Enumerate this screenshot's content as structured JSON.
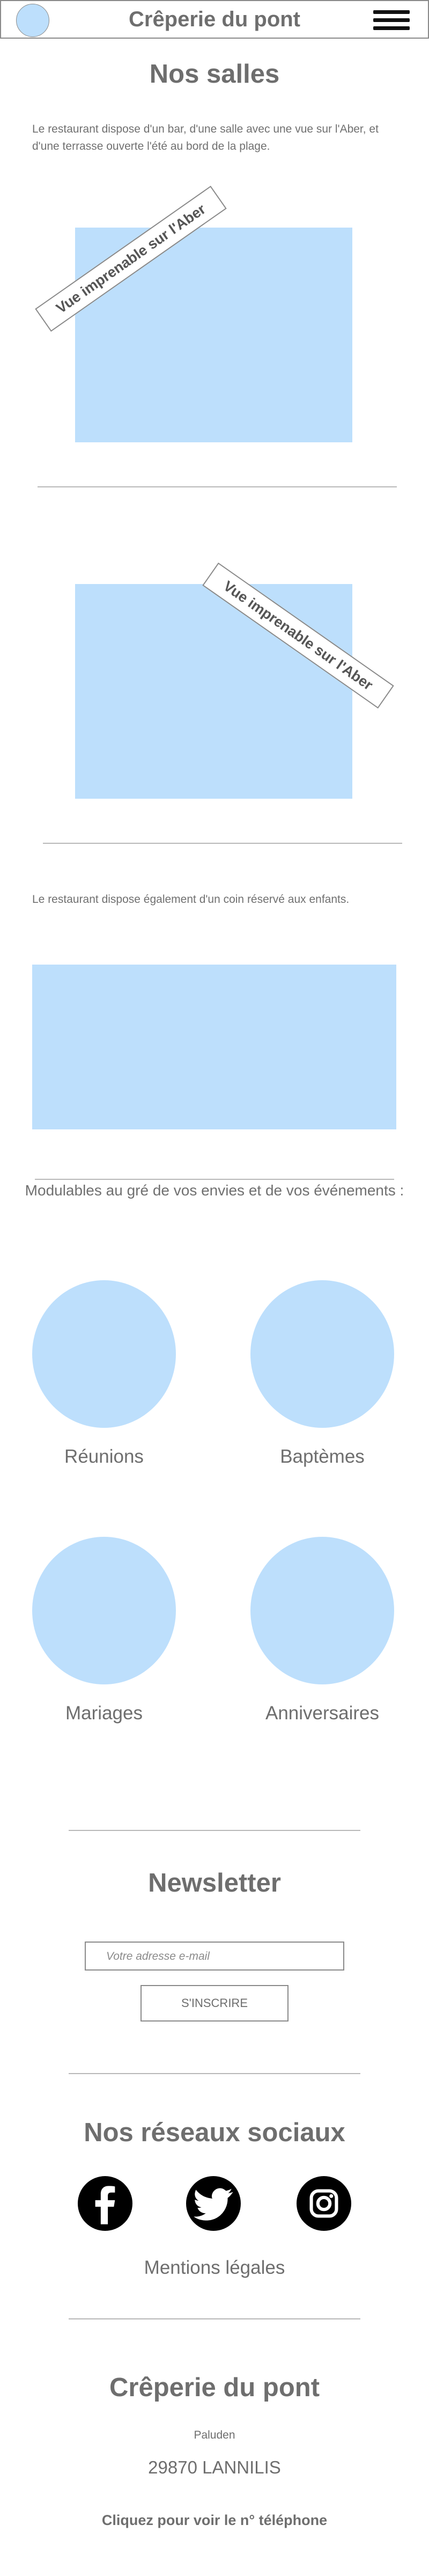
{
  "header": {
    "title": "Crêperie du pont"
  },
  "salles": {
    "title": "Nos salles",
    "intro": "Le restaurant dispose d'un bar, d'une salle avec une vue sur l'Aber, et d'une terrasse ouverte l'été au bord de la plage.",
    "banner1": "Vue imprenable sur l'Aber",
    "banner2": "Vue imprenable sur l'Aber",
    "kids_text": "Le restaurant dispose également d'un coin réservé aux enfants.",
    "modular_text": "Modulables au gré de vos envies et de vos événements :",
    "events": [
      "Réunions",
      "Baptèmes",
      "Mariages",
      "Anniversaires"
    ]
  },
  "newsletter": {
    "title": "Newsletter",
    "email_placeholder": "Votre adresse e-mail",
    "button_label": "S'INSCRIRE"
  },
  "social": {
    "title": "Nos réseaux sociaux",
    "icons": [
      "facebook-icon",
      "twitter-icon",
      "instagram-icon"
    ],
    "legal_link": "Mentions légales"
  },
  "footer": {
    "name": "Crêperie du pont",
    "locality": "Paluden",
    "city": "29870 LANNILIS",
    "phone_link": "Cliquez pour voir le n° téléphone"
  },
  "colors": {
    "placeholder_blue": "#bddffc",
    "text_grey": "#6e6e6e",
    "border_grey": "#8a8a8a"
  }
}
